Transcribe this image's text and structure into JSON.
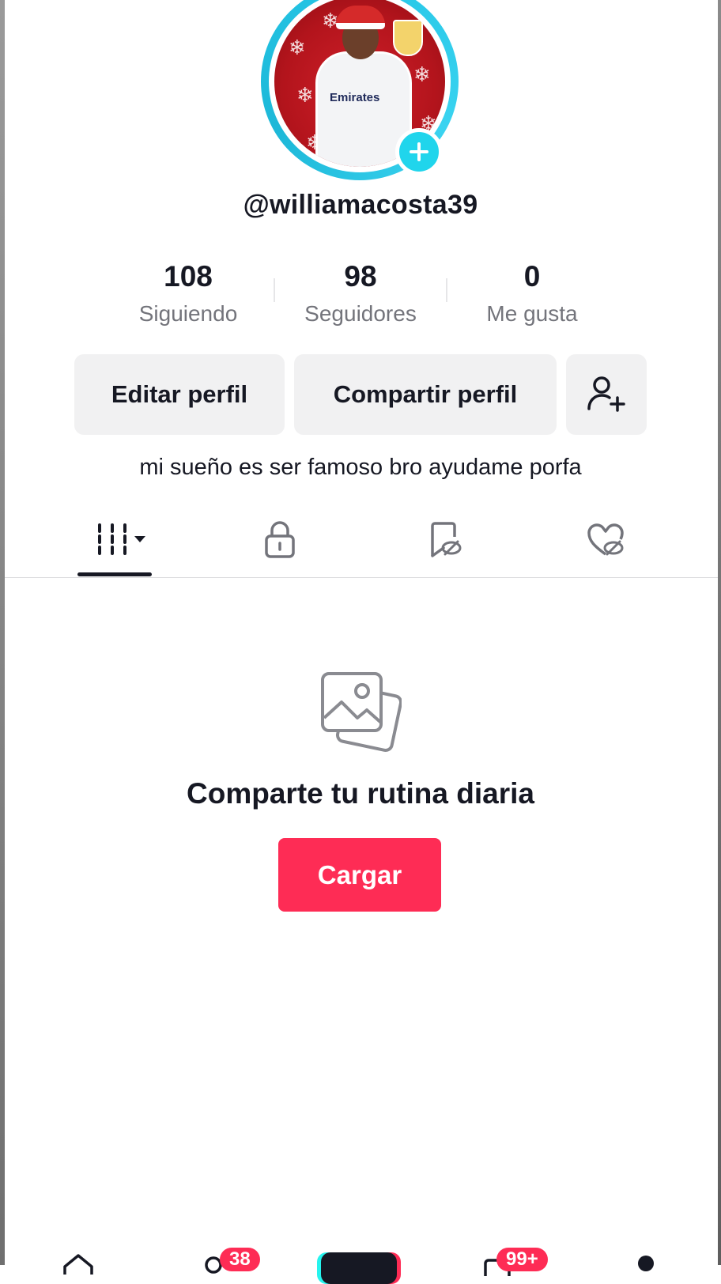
{
  "profile": {
    "username": "@williamacosta39",
    "avatar_overlay_text": "Emirates"
  },
  "stats": [
    {
      "value": "108",
      "label": "Siguiendo"
    },
    {
      "value": "98",
      "label": "Seguidores"
    },
    {
      "value": "0",
      "label": "Me gusta"
    }
  ],
  "actions": {
    "edit_label": "Editar perfil",
    "share_label": "Compartir perfil"
  },
  "bio": "mi sueño es ser famoso bro ayudame porfa",
  "tabs": [
    {
      "icon": "videos-grid-icon",
      "active": true
    },
    {
      "icon": "lock-icon",
      "active": false
    },
    {
      "icon": "favorites-hidden-icon",
      "active": false
    },
    {
      "icon": "liked-hidden-icon",
      "active": false
    }
  ],
  "empty_state": {
    "title": "Comparte tu rutina diaria",
    "button_label": "Cargar"
  },
  "bottom_nav": {
    "friends_badge": "38",
    "inbox_badge": "99+"
  },
  "colors": {
    "accent": "#fe2c55",
    "avatar_ring": "#25c6e6",
    "add_button": "#20d5ec",
    "text_primary": "#161823",
    "text_secondary": "#73747b",
    "button_bg": "#f1f1f2"
  }
}
